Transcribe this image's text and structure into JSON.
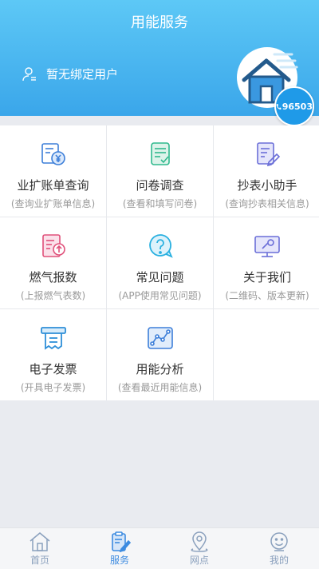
{
  "header": {
    "title": "用能服务",
    "user_text": "暂无绑定用户",
    "hotline": "96503"
  },
  "services": [
    {
      "label": "业扩账单查询",
      "sub": "(查询业扩账单信息)",
      "icon": "bill-yuan-icon"
    },
    {
      "label": "问卷调查",
      "sub": "(查看和填写问卷)",
      "icon": "survey-icon"
    },
    {
      "label": "抄表小助手",
      "sub": "(查询抄表相关信息)",
      "icon": "meter-edit-icon"
    },
    {
      "label": "燃气报数",
      "sub": "(上报燃气表数)",
      "icon": "report-upload-icon"
    },
    {
      "label": "常见问题",
      "sub": "(APP使用常见问题)",
      "icon": "question-icon"
    },
    {
      "label": "关于我们",
      "sub": "(二维码、版本更新)",
      "icon": "monitor-wrench-icon"
    },
    {
      "label": "电子发票",
      "sub": "(开具电子发票)",
      "icon": "invoice-icon"
    },
    {
      "label": "用能分析",
      "sub": "(查看最近用能信息)",
      "icon": "analysis-chart-icon"
    }
  ],
  "tabs": [
    {
      "label": "首页",
      "icon": "home-icon",
      "active": false
    },
    {
      "label": "服务",
      "icon": "service-icon",
      "active": true
    },
    {
      "label": "网点",
      "icon": "location-icon",
      "active": false
    },
    {
      "label": "我的",
      "icon": "profile-icon",
      "active": false
    }
  ],
  "colors": {
    "header_top": "#5dc8f6",
    "header_bottom": "#3aa6ea",
    "tab_active": "#3d8be0",
    "tab_inactive": "#8aa0bd"
  }
}
